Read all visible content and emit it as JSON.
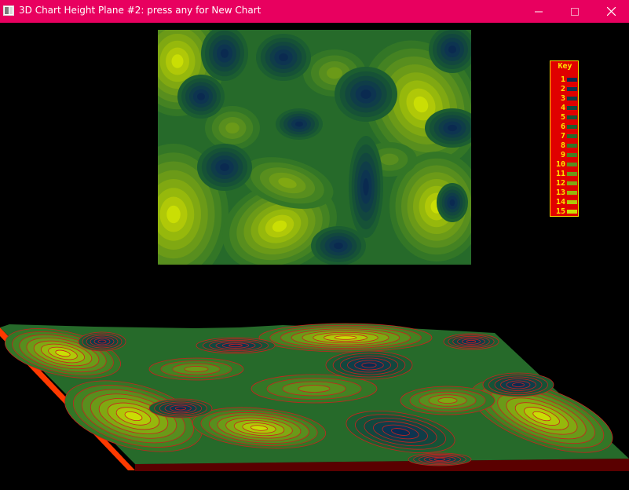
{
  "window": {
    "title": "3D Chart Height Plane #2: press any for New Chart",
    "app_icon": "app-window-icon",
    "controls": {
      "minimize": "minimize-icon",
      "maximize": "maximize-icon",
      "close": "close-icon"
    }
  },
  "key": {
    "title": "Key",
    "levels": [
      {
        "label": "1",
        "color": "#0a2a50"
      },
      {
        "label": "2",
        "color": "#0d3450"
      },
      {
        "label": "3",
        "color": "#0f3d48"
      },
      {
        "label": "4",
        "color": "#12473e"
      },
      {
        "label": "5",
        "color": "#165236"
      },
      {
        "label": "6",
        "color": "#1c5e30"
      },
      {
        "label": "7",
        "color": "#266a2a"
      },
      {
        "label": "8",
        "color": "#337626"
      },
      {
        "label": "9",
        "color": "#448222"
      },
      {
        "label": "10",
        "color": "#588e1e"
      },
      {
        "label": "11",
        "color": "#6b9a18"
      },
      {
        "label": "12",
        "color": "#80a812"
      },
      {
        "label": "13",
        "color": "#96b80c"
      },
      {
        "label": "14",
        "color": "#b0c808"
      },
      {
        "label": "15",
        "color": "#cade04"
      }
    ]
  },
  "colors": {
    "title_bar": "#e8005f",
    "contour_line": "#c8221e",
    "plane_side_left": "#ff3a00",
    "plane_side_front": "#5a0000"
  }
}
